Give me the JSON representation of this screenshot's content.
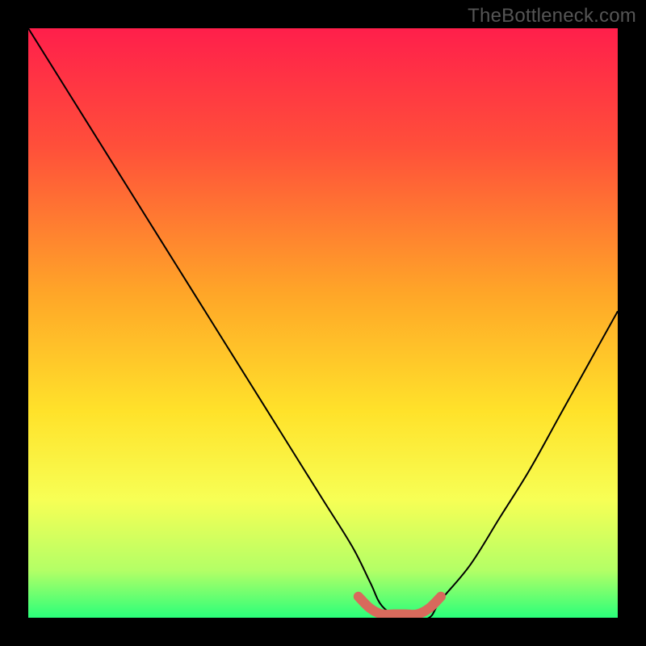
{
  "watermark": "TheBottleneck.com",
  "chart_data": {
    "type": "line",
    "title": "",
    "xlabel": "",
    "ylabel": "",
    "xlim": [
      0,
      100
    ],
    "ylim": [
      0,
      100
    ],
    "grid": false,
    "legend": false,
    "gradient_stops": [
      {
        "offset": 0.0,
        "color": "#ff1f4b"
      },
      {
        "offset": 0.2,
        "color": "#ff4f3a"
      },
      {
        "offset": 0.45,
        "color": "#ffa628"
      },
      {
        "offset": 0.65,
        "color": "#ffe22a"
      },
      {
        "offset": 0.8,
        "color": "#f7ff55"
      },
      {
        "offset": 0.92,
        "color": "#b3ff66"
      },
      {
        "offset": 1.0,
        "color": "#2aff7a"
      }
    ],
    "series": [
      {
        "name": "bottleneck-curve",
        "x": [
          0,
          5,
          10,
          15,
          20,
          25,
          30,
          35,
          40,
          45,
          50,
          55,
          58,
          60,
          63,
          65,
          68,
          70,
          75,
          80,
          85,
          90,
          95,
          100
        ],
        "values": [
          100,
          92,
          84,
          76,
          68,
          60,
          52,
          44,
          36,
          28,
          20,
          12,
          6,
          2,
          0,
          0,
          0,
          3,
          9,
          17,
          25,
          34,
          43,
          52
        ]
      },
      {
        "name": "optimal-band",
        "x": [
          56,
          58,
          60,
          62,
          64,
          66,
          68,
          70
        ],
        "values": [
          3,
          1,
          0,
          0,
          0,
          0,
          1,
          3
        ]
      }
    ]
  }
}
